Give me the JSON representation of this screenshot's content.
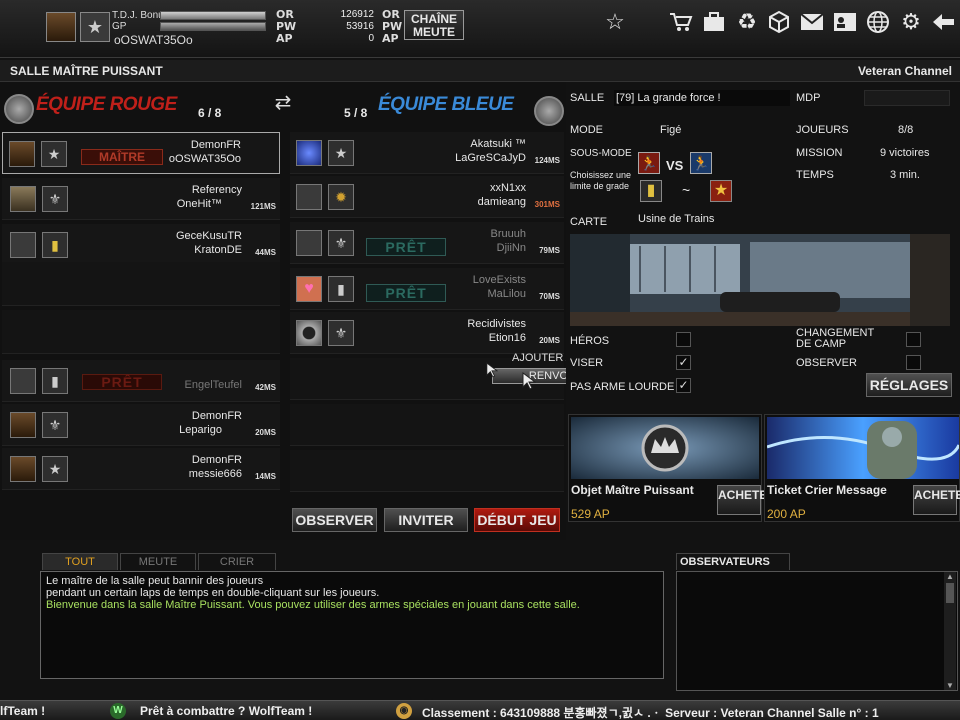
{
  "player": {
    "bonus_label": "T.D.J. Bonus",
    "gp_label": "GP",
    "name": "oOSWAT35Oo"
  },
  "currency": {
    "or_label": "OR",
    "or_value": "126912",
    "pw_label": "PW",
    "pw_value": "53916",
    "ap_label": "AP",
    "ap_value": "0",
    "chaine_label": "CHAÎNE MEUTE"
  },
  "topicons": [
    "star-icon",
    "cart-icon",
    "briefcase-icon",
    "recycle-icon",
    "box-icon",
    "mail-icon",
    "contacts-icon",
    "globe-icon",
    "gear-icon",
    "back-arrow-icon"
  ],
  "header": {
    "room_title": "SALLE MAÎTRE PUISSANT",
    "channel": "Veteran Channel"
  },
  "red_team": {
    "title": "ÉQUIPE ROUGE",
    "count": "6 / 8",
    "color": "#c0201a",
    "slots": [
      {
        "line1": "DemonFR",
        "line2": "oOSWAT35Oo",
        "badge": "MAÎTRE",
        "ping": ""
      },
      {
        "line1": "Referency",
        "line2": "OneHit™",
        "ping": "121MS"
      },
      {
        "line1": "GeceKusuTR",
        "line2": "KratonDE",
        "ping": "44MS"
      },
      {
        "line1": "",
        "line2": "",
        "ping": ""
      },
      {
        "line1": "",
        "line2": "",
        "ping": ""
      },
      {
        "line1": "EngelTeufel",
        "line2": "",
        "badge": "PRÊT",
        "ping": "42MS"
      },
      {
        "line1": "DemonFR",
        "line2": "Leparigo",
        "ping": "20MS"
      },
      {
        "line1": "DemonFR",
        "line2": "messie666",
        "ping": "14MS"
      }
    ]
  },
  "blue_team": {
    "title": "ÉQUIPE BLEUE",
    "count": "5 / 8",
    "color": "#2a78c8",
    "slots": [
      {
        "line1": "Akatsuki ™",
        "line2": "LaGreSCaJyD",
        "ping": "124MS"
      },
      {
        "line1": "xxN1xx",
        "line2": "damieang",
        "ping": "301MS"
      },
      {
        "line1": "Bruuuh",
        "line2": "DjiiNn",
        "badge": "PRÊT",
        "ping": "79MS"
      },
      {
        "line1": "LoveExists",
        "line2": "MaLilou",
        "badge": "PRÊT",
        "ping": "70MS"
      },
      {
        "line1": "Recidivistes",
        "line2": "Etion16",
        "ping": "20MS"
      }
    ]
  },
  "context_menu": {
    "item1": "AJOUTER AMI",
    "item2": "RENVOI"
  },
  "actions": {
    "observer": "OBSERVER",
    "inviter": "INVITER",
    "debut": "DÉBUT JEU"
  },
  "room": {
    "salle_label": "SALLE",
    "salle_value": "[79] La grande force !",
    "mdp_label": "MDP",
    "mode_label": "MODE",
    "mode_value": "Figé",
    "joueurs_label": "JOUEURS",
    "joueurs_value": "8/8",
    "sousmode_label": "SOUS-MODE",
    "vs": "VS",
    "mission_label": "MISSION",
    "mission_value": "9 victoires",
    "grade_label": "Choisissez une limite de grade",
    "tilde": "~",
    "temps_label": "TEMPS",
    "temps_value": "3 min.",
    "carte_label": "CARTE",
    "carte_value": "Usine de Trains",
    "heros_label": "HÉROS",
    "viser_label": "VISER",
    "arme_label": "PAS ARME LOURDE",
    "changement_label": "CHANGEMENT DE CAMP",
    "observer_label": "OBSERVER",
    "reglages_label": "RÉGLAGES"
  },
  "shop": [
    {
      "name": "Objet Maître Puissant",
      "price": "529 AP",
      "button": "ACHETER"
    },
    {
      "name": "Ticket Crier Message",
      "price": "200 AP",
      "button": "ACHETER"
    }
  ],
  "chat": {
    "tabs": [
      "TOUT",
      "MEUTE",
      "CRIER"
    ],
    "line1": "Le maître de la salle peut bannir des joueurs",
    "line2": "pendant un certain laps de temps en double-cliquant sur les joueurs.",
    "line3": "Bienvenue dans la salle Maître Puissant. Vous pouvez utiliser des armes spéciales en jouant dans cette salle."
  },
  "observers": {
    "title": "OBSERVATEURS"
  },
  "ticker": {
    "left": "lfTeam !",
    "msg": "Prêt à combattre ? WolfTeam !",
    "right": "Classement : 643109888  분홍빠졌ㄱ,귌ㅅ .ㆍ Serveur : Veteran Channel Salle n° : 1"
  }
}
